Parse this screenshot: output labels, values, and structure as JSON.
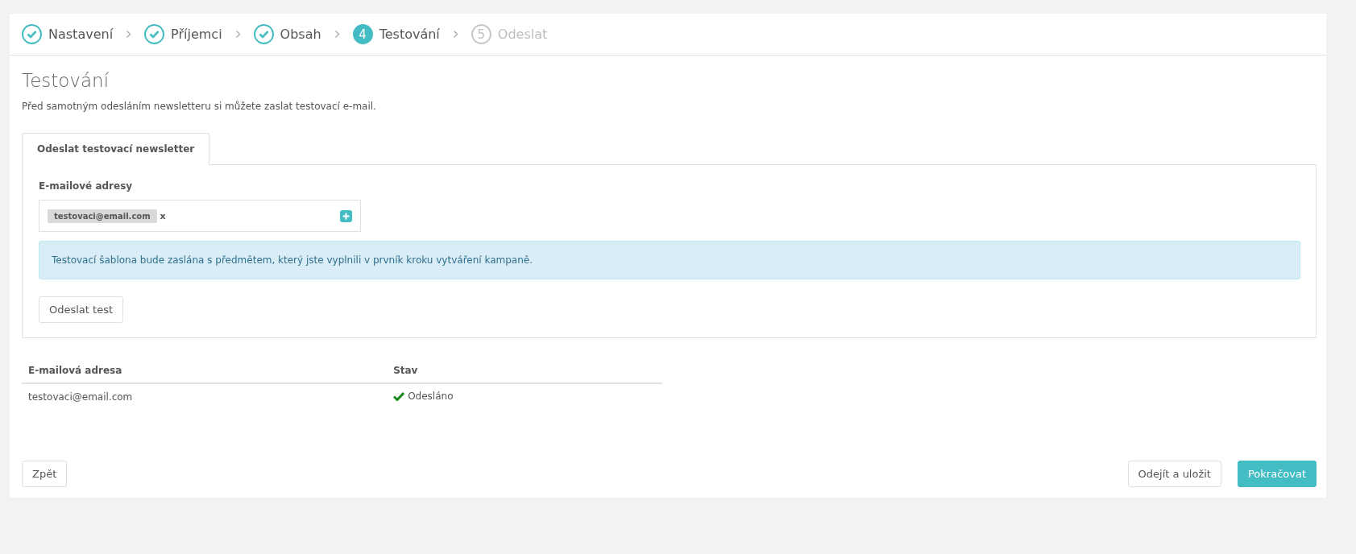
{
  "steps": [
    {
      "label": "Nastavení",
      "kind": "done"
    },
    {
      "label": "Příjemci",
      "kind": "done"
    },
    {
      "label": "Obsah",
      "kind": "done"
    },
    {
      "number": "4",
      "label": "Testování",
      "kind": "current"
    },
    {
      "number": "5",
      "label": "Odeslat",
      "kind": "pending"
    }
  ],
  "title": "Testování",
  "description": "Před samotným odesláním newsletteru si můžete zaslat testovací e-mail.",
  "tabs": [
    {
      "label": "Odeslat testovací newsletter",
      "selected": true
    }
  ],
  "email_field": {
    "label": "E-mailové adresy",
    "tags": [
      {
        "text": "testovaci@email.com",
        "remove": "x"
      }
    ]
  },
  "alert": "Testovací šablona bude zaslána s předmětem, který jste vyplnili v prvník kroku vytváření kampaně.",
  "send_button": "Odeslat test",
  "table": {
    "columns": [
      "E-mailová adresa",
      "Stav"
    ],
    "rows": [
      {
        "email": "testovaci@email.com",
        "status": "Odesláno",
        "kind": "sent"
      }
    ]
  },
  "footer": {
    "back": "Zpět",
    "save": "Odejít a uložit",
    "next": "Pokračovat"
  }
}
